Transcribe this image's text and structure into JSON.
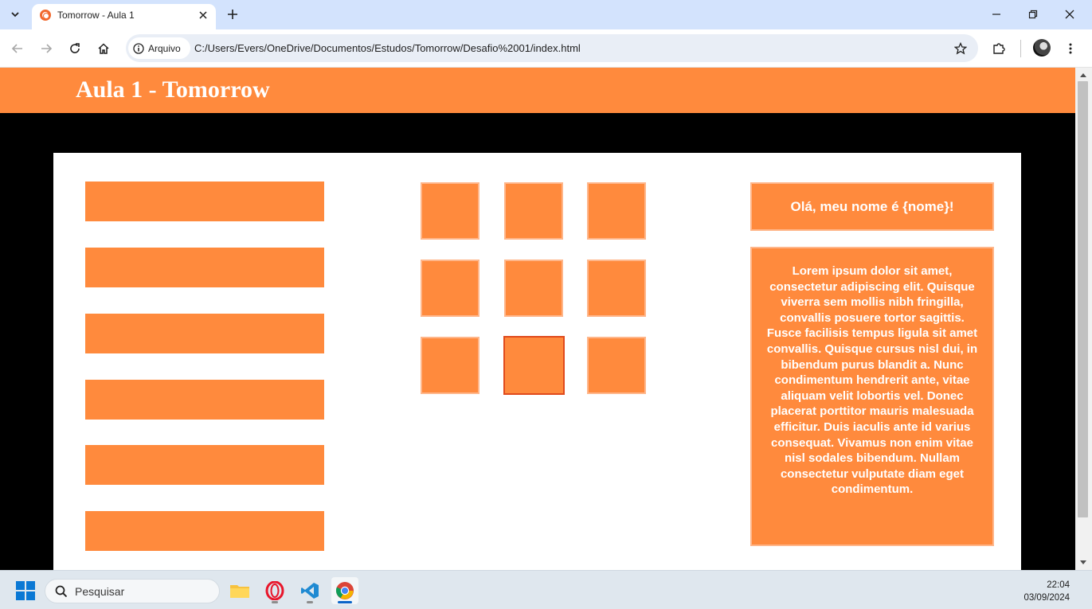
{
  "browser": {
    "tab": {
      "title": "Tomorrow - Aula 1"
    },
    "address": {
      "site_info_label": "Arquivo",
      "url": "C:/Users/Evers/OneDrive/Documentos/Estudos/Tomorrow/Desafio%2001/index.html"
    }
  },
  "page": {
    "header_title": "Aula 1 - Tomorrow",
    "bars": [
      "",
      "",
      "",
      "",
      "",
      ""
    ],
    "grid": {
      "rows": 3,
      "cols": 3,
      "hovered_index": 7
    },
    "greeting": "Olá, meu nome é {nome}!",
    "lorem": "Lorem ipsum dolor sit amet, consectetur adipiscing elit. Quisque viverra sem mollis nibh fringilla, convallis posuere tortor sagittis. Fusce facilisis tempus ligula sit amet convallis. Quisque cursus nisl dui, in bibendum purus blandit a. Nunc condimentum hendrerit ante, vitae aliquam velit lobortis vel. Donec placerat porttitor mauris malesuada efficitur. Duis iaculis ante id varius consequat. Vivamus non enim vitae nisl sodales bibendum. Nullam consectetur vulputate diam eget condimentum."
  },
  "taskbar": {
    "search_placeholder": "Pesquisar",
    "apps": [
      "file-explorer-icon",
      "opera-icon",
      "vscode-icon",
      "chrome-icon"
    ],
    "time": "22:04",
    "date": "03/09/2024"
  },
  "colors": {
    "accent": "#ff8a3d",
    "accent_border": "#ffb68a",
    "hover_border": "#e04a1c",
    "page_bg": "#000000",
    "card_bg": "#ffffff"
  }
}
